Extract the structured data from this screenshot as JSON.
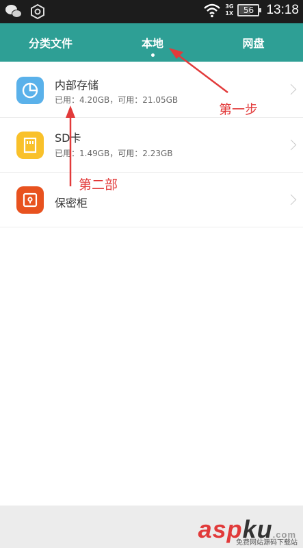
{
  "status_bar": {
    "net_top": "3G",
    "net_bottom": "1X",
    "battery": "56",
    "battery_level": 0.56,
    "time": "13:18",
    "icons": [
      "wechat-icon",
      "hexagon-icon",
      "wifi-icon",
      "signal-icon",
      "battery-icon"
    ]
  },
  "tabs": [
    {
      "label": "分类文件",
      "active": false
    },
    {
      "label": "本地",
      "active": true
    },
    {
      "label": "网盘",
      "active": false
    }
  ],
  "storage": [
    {
      "title": "内部存储",
      "subtitle": "已用：4.20GB，可用：21.05GB",
      "icon": "pie-chart-icon",
      "color": "#5ab1ea"
    },
    {
      "title": "SD卡",
      "subtitle": "已用：1.49GB，可用：2.23GB",
      "icon": "sd-card-icon",
      "color": "#f9c12a"
    },
    {
      "title": "保密柜",
      "subtitle": "",
      "icon": "safe-icon",
      "color": "#e8521f"
    }
  ],
  "annotations": {
    "step1": "第一步",
    "step2": "第二部",
    "color": "#e23a3a"
  },
  "watermark": {
    "asp": "asp",
    "ku": "ku",
    "dotcom": ".com",
    "subtitle": "免费网站源码下载站"
  },
  "colors": {
    "tab_bar": "#2e9f95",
    "status_bar": "#1c1c1c"
  }
}
